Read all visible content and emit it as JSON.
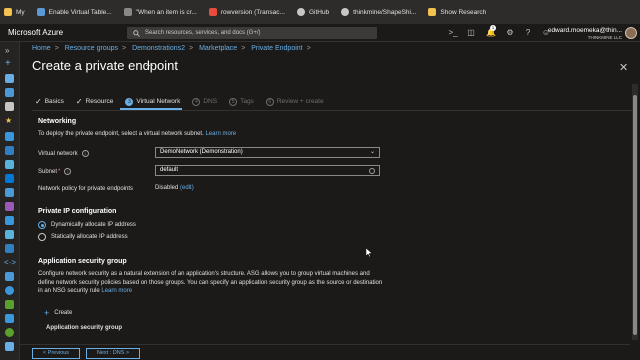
{
  "bookmarks": [
    {
      "label": "My",
      "icon": "folder-icon",
      "color": "#f2c14e"
    },
    {
      "label": "Enable Virtual Table...",
      "icon": "page-icon",
      "color": "#5b9bd5"
    },
    {
      "label": "\"When an item is cr...",
      "icon": "page-icon",
      "color": "#8a8886"
    },
    {
      "label": "rowversion (Transac...",
      "icon": "microsoft-icon",
      "color": "#e74c3c"
    },
    {
      "label": "GitHub",
      "icon": "github-icon",
      "color": "#c8c6c4"
    },
    {
      "label": "thinkmine/ShapeShi...",
      "icon": "github-icon",
      "color": "#c8c6c4"
    },
    {
      "label": "Show Research",
      "icon": "folder-icon",
      "color": "#f2c14e"
    }
  ],
  "header": {
    "brand": "Microsoft Azure",
    "search_placeholder": "Search resources, services, and docs (G+/)",
    "notification_count": "1",
    "user_name": "edward.moemeka@thin...",
    "tenant": "THINKMINE LLC"
  },
  "breadcrumb": [
    "Home",
    "Resource groups",
    "Demonstrations2",
    "Marketplace",
    "Private Endpoint"
  ],
  "title": "Create a private endpoint",
  "tabs": [
    {
      "label": "Basics",
      "state": "done"
    },
    {
      "label": "Resource",
      "state": "done"
    },
    {
      "label": "Virtual Network",
      "num": "3",
      "state": "active"
    },
    {
      "label": "DNS",
      "num": "4",
      "state": "disabled"
    },
    {
      "label": "Tags",
      "num": "5",
      "state": "disabled"
    },
    {
      "label": "Review + create",
      "num": "6",
      "state": "disabled"
    }
  ],
  "networking": {
    "heading": "Networking",
    "description": "To deploy the private endpoint, select a virtual network subnet.",
    "learn_more": "Learn more",
    "vnet_label": "Virtual network",
    "vnet_value": "DemoNetwork (Demonstration)",
    "subnet_label": "Subnet",
    "subnet_required": "*",
    "subnet_value": "default",
    "policy_label": "Network policy for private endpoints",
    "policy_value": "Disabled",
    "policy_edit": "(edit)"
  },
  "private_ip": {
    "heading": "Private IP configuration",
    "option_dynamic": "Dynamically allocate IP address",
    "option_static": "Statically allocate IP address",
    "selected": "dynamic"
  },
  "asg": {
    "heading": "Application security group",
    "description": "Configure network security as a natural extension of an application's structure. ASG allows you to group virtual machines and define network security policies based on those groups. You can specify an application security group as the source or destination in an NSG security rule",
    "learn_more": "Learn more",
    "create_label": "Create",
    "column_header": "Application security group"
  },
  "footer": {
    "previous": "< Previous",
    "next": "Next : DNS >"
  },
  "colors": {
    "accent": "#69afe5",
    "background": "#1b1a19"
  }
}
